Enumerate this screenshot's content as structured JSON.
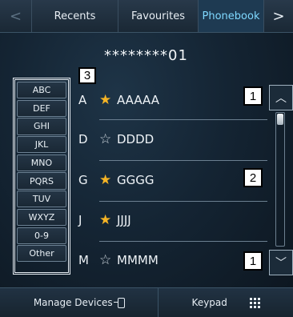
{
  "tabs": {
    "prev_arrow": "<",
    "recents": "Recents",
    "favourites": "Favourites",
    "phonebook": "Phonebook",
    "next_arrow": ">"
  },
  "dialed_number": "********01",
  "index_letters": [
    "ABC",
    "DEF",
    "GHI",
    "JKL",
    "MNO",
    "PQRS",
    "TUV",
    "WXYZ",
    "0-9",
    "Other"
  ],
  "contacts": [
    {
      "letter": "A",
      "star": "★",
      "name": "AAAAA",
      "favourite": true
    },
    {
      "letter": "D",
      "star": "☆",
      "name": "DDDD",
      "favourite": false
    },
    {
      "letter": "G",
      "star": "★",
      "name": "GGGG",
      "favourite": true
    },
    {
      "letter": "J",
      "star": "★",
      "name": "JJJJ",
      "favourite": true
    },
    {
      "letter": "M",
      "star": "☆",
      "name": "MMMM",
      "favourite": false
    }
  ],
  "callouts": {
    "index_label": "3",
    "scroll_up_label": "1",
    "scrollbar_label": "2",
    "scroll_down_label": "1"
  },
  "scroll": {
    "up_symbol": "︿",
    "down_symbol": "﹀"
  },
  "bottom": {
    "manage_devices": "Manage Devices",
    "keypad": "Keypad"
  },
  "colors": {
    "active_tab_text": "#7fd8ff",
    "favourite_star": "#f5b425"
  }
}
